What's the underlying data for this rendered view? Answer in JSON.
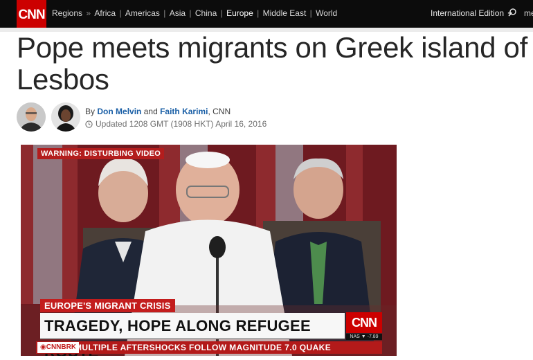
{
  "header": {
    "logo": "CNN",
    "nav": [
      {
        "label": "Regions",
        "active": false
      },
      {
        "label": "»",
        "sep": true
      },
      {
        "label": "Africa",
        "active": false
      },
      {
        "label": "|",
        "sep": true
      },
      {
        "label": "Americas",
        "active": false
      },
      {
        "label": "|",
        "sep": true
      },
      {
        "label": "Asia",
        "active": false
      },
      {
        "label": "|",
        "sep": true
      },
      {
        "label": "China",
        "active": false
      },
      {
        "label": "|",
        "sep": true
      },
      {
        "label": "Europe",
        "active": true
      },
      {
        "label": "|",
        "sep": true
      },
      {
        "label": "Middle East",
        "active": false
      },
      {
        "label": "|",
        "sep": true
      },
      {
        "label": "World",
        "active": false
      }
    ],
    "edition": "International Edition",
    "edition_plus": "+",
    "overflow": "me"
  },
  "article": {
    "headline": "Pope meets migrants on Greek island of Lesbos",
    "byline_prefix": "By",
    "author1": "Don Melvin",
    "and": "and",
    "author2": "Faith Karimi",
    "org": ", CNN",
    "updated": "Updated 1208 GMT (1908 HKT) April 16, 2016"
  },
  "video": {
    "warning": "WARNING: DISTURBING VIDEO",
    "topic": "EUROPE'S MIGRANT CRISIS",
    "headline": "TRAGEDY, HOPE ALONG REFUGEE ROUTE",
    "network_logo": "CNN",
    "ticker": "NAS ▼ -7.89",
    "brk_tag": "◉CNNBRK",
    "brk_text": "MULTIPLE AFTERSHOCKS FOLLOW MAGNITUDE 7.0 QUAKE"
  },
  "colors": {
    "brand_red": "#cc0000",
    "nav_bg": "#0c0c0c",
    "link_blue": "#1a5fa6"
  }
}
